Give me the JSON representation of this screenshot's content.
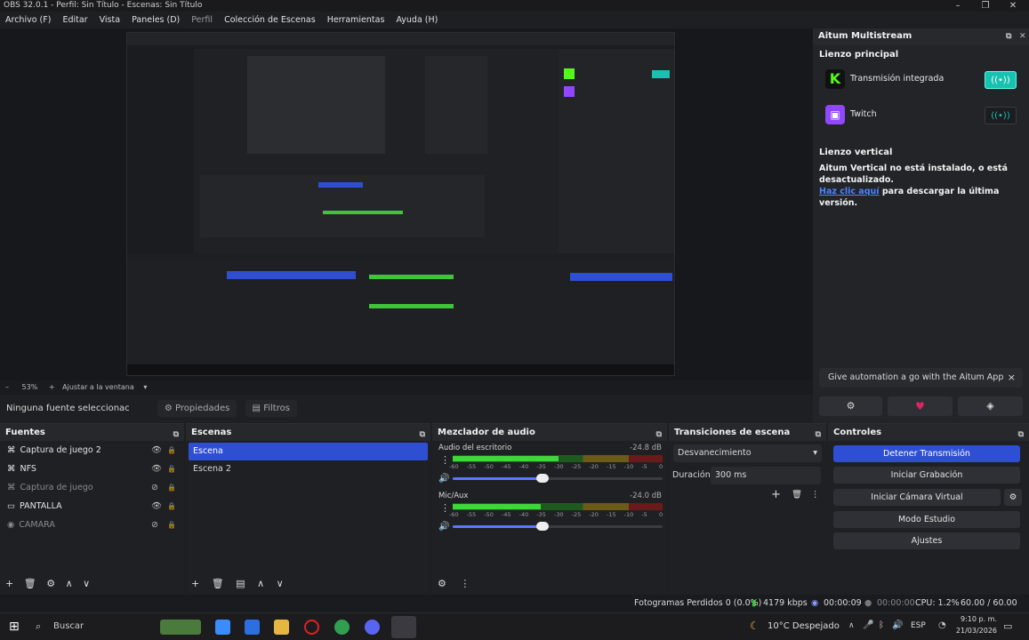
{
  "window": {
    "title": "OBS 32.0.1 - Perfil: Sin Título - Escenas: Sin Título"
  },
  "menu": [
    "Archivo (F)",
    "Editar",
    "Vista",
    "Paneles (D)",
    "Perfil",
    "Colección de Escenas",
    "Herramientas",
    "Ayuda (H)"
  ],
  "zoombar": {
    "zoom": "53%",
    "fit": "Ajustar a la ventana"
  },
  "props": {
    "no_source": "Ninguna fuente seleccionac",
    "properties": "Propiedades",
    "filters": "Filtros"
  },
  "multistream": {
    "title": "Aitum Multistream",
    "main_canvas": "Lienzo principal",
    "outputs": [
      {
        "name": "Transmisión integrada",
        "icon": "kick-icon",
        "color": "#53fc18",
        "active": true
      },
      {
        "name": "Twitch",
        "icon": "twitch-icon",
        "color": "#9146ff",
        "active": false
      }
    ],
    "vertical_title": "Lienzo vertical",
    "vertical_msg": "Aitum Vertical no está instalado, o está desactualizado.",
    "link": "Haz clic aquí",
    "link_rest": " para descargar la última versión.",
    "promo": "Give automation a go with the Aitum App",
    "promo_close": "×"
  },
  "sources": {
    "title": "Fuentes",
    "items": [
      {
        "name": "Captura de juego 2",
        "icon": "gamepad-icon",
        "visible": true
      },
      {
        "name": "NFS",
        "icon": "gamepad-icon",
        "visible": true
      },
      {
        "name": "Captura de juego",
        "icon": "gamepad-icon",
        "visible": false
      },
      {
        "name": "PANTALLA",
        "icon": "monitor-icon",
        "visible": true
      },
      {
        "name": "CAMARA",
        "icon": "camera-icon",
        "visible": false
      }
    ]
  },
  "scenes": {
    "title": "Escenas",
    "items": [
      "Escena",
      "Escena 2"
    ]
  },
  "mixer": {
    "title": "Mezclador de audio",
    "channels": [
      {
        "name": "Audio del escritorio",
        "db": "-24.8 dB",
        "level": 0.7
      },
      {
        "name": "Mic/Aux",
        "db": "-24.0 dB",
        "level": 0.58
      }
    ],
    "ticks": [
      "-60",
      "-55",
      "-50",
      "-45",
      "-40",
      "-35",
      "-30",
      "-25",
      "-20",
      "-15",
      "-10",
      "-5",
      "0"
    ]
  },
  "transitions": {
    "title": "Transiciones de escena",
    "selected": "Desvanecimiento",
    "duration_label": "Duración",
    "duration": "300 ms"
  },
  "controls": {
    "title": "Controles",
    "buttons": [
      "Detener Transmisión",
      "Iniciar Grabación",
      "Iniciar Cámara Virtual",
      "Modo Estudio",
      "Ajustes"
    ]
  },
  "status": {
    "dropped": "Fotogramas Perdidos 0 (0.0%)",
    "bitrate": "4179 kbps",
    "stream_time": "00:00:09",
    "rec_time": "00:00:00",
    "cpu": "CPU: 1.2%",
    "fps": "60.00 / 60.00 FPS"
  },
  "taskbar": {
    "search": "Buscar",
    "weather": "10°C  Despejado",
    "lang": "ESP",
    "time": "9:10 p. m.",
    "date": "21/03/2026"
  },
  "colors": {
    "accent": "#2f4fd3",
    "kick": "#53fc18",
    "twitch": "#9146ff",
    "toggle_on": "#19c2b0"
  }
}
